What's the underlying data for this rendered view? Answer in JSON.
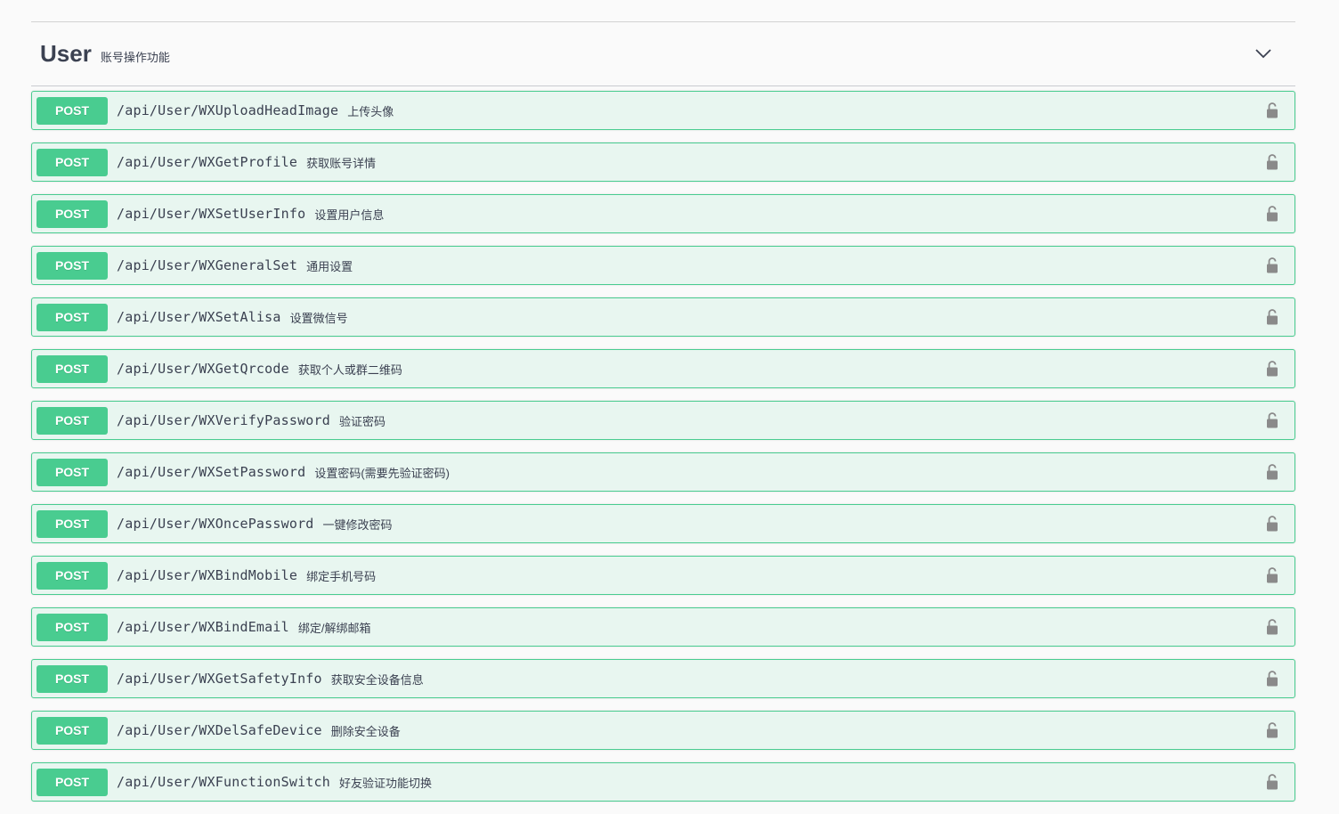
{
  "tag": {
    "name": "User",
    "description": "账号操作功能",
    "chevron_icon": "chevron-down-icon"
  },
  "colors": {
    "post_method": "#49cc90",
    "post_background": "#e8f6f0",
    "text": "#3b4151"
  },
  "operations": [
    {
      "method": "POST",
      "path": "/api/User/WXUploadHeadImage",
      "summary": "上传头像"
    },
    {
      "method": "POST",
      "path": "/api/User/WXGetProfile",
      "summary": "获取账号详情"
    },
    {
      "method": "POST",
      "path": "/api/User/WXSetUserInfo",
      "summary": "设置用户信息"
    },
    {
      "method": "POST",
      "path": "/api/User/WXGeneralSet",
      "summary": "通用设置"
    },
    {
      "method": "POST",
      "path": "/api/User/WXSetAlisa",
      "summary": "设置微信号"
    },
    {
      "method": "POST",
      "path": "/api/User/WXGetQrcode",
      "summary": "获取个人或群二维码"
    },
    {
      "method": "POST",
      "path": "/api/User/WXVerifyPassword",
      "summary": "验证密码"
    },
    {
      "method": "POST",
      "path": "/api/User/WXSetPassword",
      "summary": "设置密码(需要先验证密码)"
    },
    {
      "method": "POST",
      "path": "/api/User/WXOncePassword",
      "summary": "一键修改密码"
    },
    {
      "method": "POST",
      "path": "/api/User/WXBindMobile",
      "summary": "绑定手机号码"
    },
    {
      "method": "POST",
      "path": "/api/User/WXBindEmail",
      "summary": "绑定/解绑邮箱"
    },
    {
      "method": "POST",
      "path": "/api/User/WXGetSafetyInfo",
      "summary": "获取安全设备信息"
    },
    {
      "method": "POST",
      "path": "/api/User/WXDelSafeDevice",
      "summary": "删除安全设备"
    },
    {
      "method": "POST",
      "path": "/api/User/WXFunctionSwitch",
      "summary": "好友验证功能切换"
    }
  ]
}
